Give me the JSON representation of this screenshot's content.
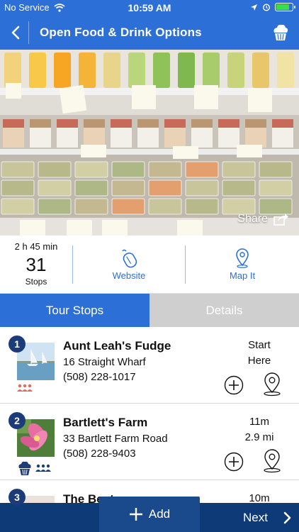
{
  "status_bar": {
    "carrier": "No Service",
    "time": "10:59 AM",
    "battery_level": 0.85
  },
  "nav": {
    "title": "Open Food & Drink Options",
    "back_icon": "chevron-left-icon",
    "right_icon": "cupcake-icon"
  },
  "hero": {
    "share_label": "Share"
  },
  "info": {
    "duration": "2 h 45 min",
    "stops_count": "31",
    "stops_label": "Stops",
    "website_label": "Website",
    "map_label": "Map It"
  },
  "tabs": [
    {
      "label": "Tour Stops",
      "active": true
    },
    {
      "label": "Details",
      "active": false
    }
  ],
  "stops": [
    {
      "number": "1",
      "name": "Aunt Leah's Fudge",
      "address": "16 Straight Wharf",
      "phone": "(508) 228-1017",
      "right_line1": "Start",
      "right_line2": "Here"
    },
    {
      "number": "2",
      "name": "Bartlett's Farm",
      "address": "33 Bartlett Farm Road",
      "phone": "(508) 228-9403",
      "right_line1": "11m",
      "right_line2": "2.9 mi"
    },
    {
      "number": "3",
      "name": "The Beet",
      "address": "",
      "phone": "",
      "right_line1": "10m",
      "right_line2": ""
    }
  ],
  "bottom": {
    "add_label": "Add",
    "next_label": "Next"
  },
  "colors": {
    "primary": "#2c6fd6",
    "navy": "#0e3a78",
    "badge": "#1b3c78",
    "inactive_tab": "#cfcfcf",
    "tag_red": "#e66a5c",
    "tag_blue": "#1b3c78"
  }
}
